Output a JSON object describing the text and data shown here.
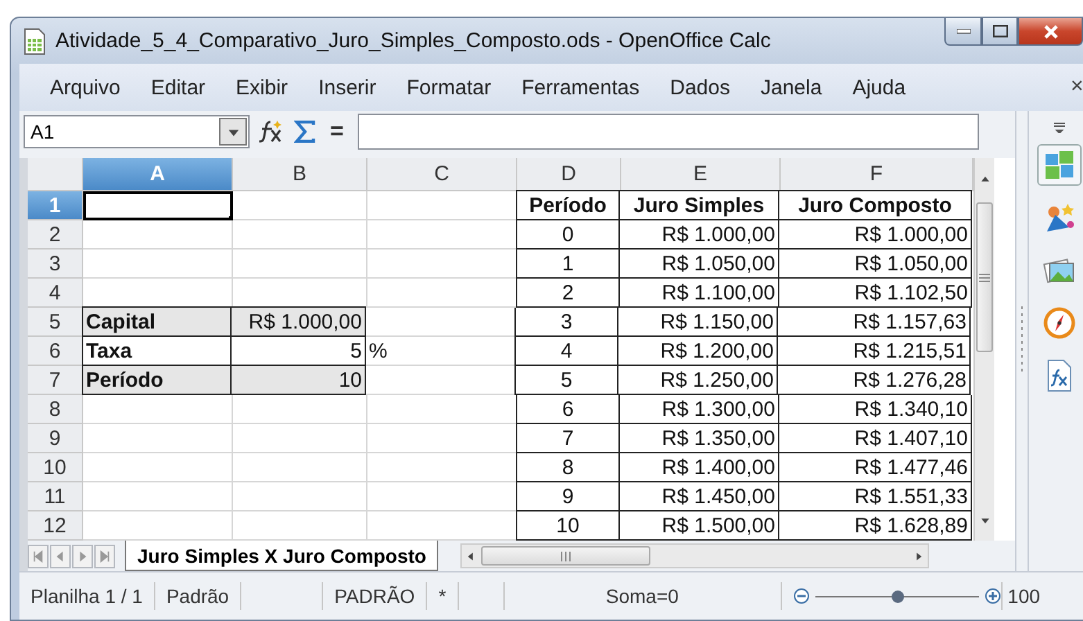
{
  "window": {
    "title": "Atividade_5_4_Comparativo_Juro_Simples_Composto.ods - OpenOffice Calc"
  },
  "menu": [
    {
      "label": "Arquivo"
    },
    {
      "label": "Editar"
    },
    {
      "label": "Exibir"
    },
    {
      "label": "Inserir"
    },
    {
      "label": "Formatar"
    },
    {
      "label": "Ferramentas"
    },
    {
      "label": "Dados"
    },
    {
      "label": "Janela"
    },
    {
      "label": "Ajuda"
    }
  ],
  "menu_close": "×",
  "formula_bar": {
    "name_box": "A1",
    "equals": "="
  },
  "grid": {
    "columns": [
      {
        "label": "A",
        "selected": true
      },
      {
        "label": "B",
        "selected": false
      },
      {
        "label": "C",
        "selected": false
      },
      {
        "label": "D",
        "selected": false
      },
      {
        "label": "E",
        "selected": false
      },
      {
        "label": "F",
        "selected": false
      }
    ],
    "rows": [
      {
        "label": "1",
        "selected": true,
        "cells": [
          null,
          null,
          null,
          {
            "text": "Período",
            "kind": "header"
          },
          {
            "text": "Juro Simples",
            "kind": "header"
          },
          {
            "text": "Juro Composto",
            "kind": "header"
          }
        ]
      },
      {
        "label": "2",
        "selected": false,
        "cells": [
          null,
          null,
          null,
          {
            "text": "0",
            "kind": "number"
          },
          {
            "text": "R$ 1.000,00",
            "kind": "money"
          },
          {
            "text": "R$ 1.000,00",
            "kind": "money"
          }
        ]
      },
      {
        "label": "3",
        "selected": false,
        "cells": [
          null,
          null,
          null,
          {
            "text": "1",
            "kind": "number"
          },
          {
            "text": "R$ 1.050,00",
            "kind": "money"
          },
          {
            "text": "R$ 1.050,00",
            "kind": "money"
          }
        ]
      },
      {
        "label": "4",
        "selected": false,
        "cells": [
          null,
          null,
          null,
          {
            "text": "2",
            "kind": "number"
          },
          {
            "text": "R$ 1.100,00",
            "kind": "money"
          },
          {
            "text": "R$ 1.102,50",
            "kind": "money"
          }
        ]
      },
      {
        "label": "5",
        "selected": false,
        "cells": [
          {
            "text": "Capital",
            "kind": "label",
            "shaded": true
          },
          {
            "text": "R$ 1.000,00",
            "kind": "money",
            "shaded": true
          },
          null,
          {
            "text": "3",
            "kind": "number"
          },
          {
            "text": "R$ 1.150,00",
            "kind": "money"
          },
          {
            "text": "R$ 1.157,63",
            "kind": "money"
          }
        ]
      },
      {
        "label": "6",
        "selected": false,
        "cells": [
          {
            "text": "Taxa",
            "kind": "label",
            "shaded": false
          },
          {
            "text": "5",
            "kind": "money",
            "shaded": false
          },
          {
            "text": "%",
            "kind": "plain"
          },
          {
            "text": "4",
            "kind": "number"
          },
          {
            "text": "R$ 1.200,00",
            "kind": "money"
          },
          {
            "text": "R$ 1.215,51",
            "kind": "money"
          }
        ]
      },
      {
        "label": "7",
        "selected": false,
        "cells": [
          {
            "text": "Período",
            "kind": "label",
            "shaded": true
          },
          {
            "text": "10",
            "kind": "money",
            "shaded": true
          },
          null,
          {
            "text": "5",
            "kind": "number"
          },
          {
            "text": "R$ 1.250,00",
            "kind": "money"
          },
          {
            "text": "R$ 1.276,28",
            "kind": "money"
          }
        ]
      },
      {
        "label": "8",
        "selected": false,
        "cells": [
          null,
          null,
          null,
          {
            "text": "6",
            "kind": "number"
          },
          {
            "text": "R$ 1.300,00",
            "kind": "money"
          },
          {
            "text": "R$ 1.340,10",
            "kind": "money"
          }
        ]
      },
      {
        "label": "9",
        "selected": false,
        "cells": [
          null,
          null,
          null,
          {
            "text": "7",
            "kind": "number"
          },
          {
            "text": "R$ 1.350,00",
            "kind": "money"
          },
          {
            "text": "R$ 1.407,10",
            "kind": "money"
          }
        ]
      },
      {
        "label": "10",
        "selected": false,
        "cells": [
          null,
          null,
          null,
          {
            "text": "8",
            "kind": "number"
          },
          {
            "text": "R$ 1.400,00",
            "kind": "money"
          },
          {
            "text": "R$ 1.477,46",
            "kind": "money"
          }
        ]
      },
      {
        "label": "11",
        "selected": false,
        "cells": [
          null,
          null,
          null,
          {
            "text": "9",
            "kind": "number"
          },
          {
            "text": "R$ 1.450,00",
            "kind": "money"
          },
          {
            "text": "R$ 1.551,33",
            "kind": "money"
          }
        ]
      },
      {
        "label": "12",
        "selected": false,
        "cells": [
          null,
          null,
          null,
          {
            "text": "10",
            "kind": "number"
          },
          {
            "text": "R$ 1.500,00",
            "kind": "money"
          },
          {
            "text": "R$ 1.628,89",
            "kind": "money"
          }
        ]
      }
    ]
  },
  "sheet_tabs": [
    {
      "label": "Juro Simples X Juro Composto",
      "selected": true
    }
  ],
  "status_bar": {
    "sheet": "Planilha 1 / 1",
    "style": "Padrão",
    "mode": "PADRÃO",
    "modified": "*",
    "sum": "Soma=0",
    "zoom": {
      "level": 0.5,
      "reading": "100"
    }
  }
}
